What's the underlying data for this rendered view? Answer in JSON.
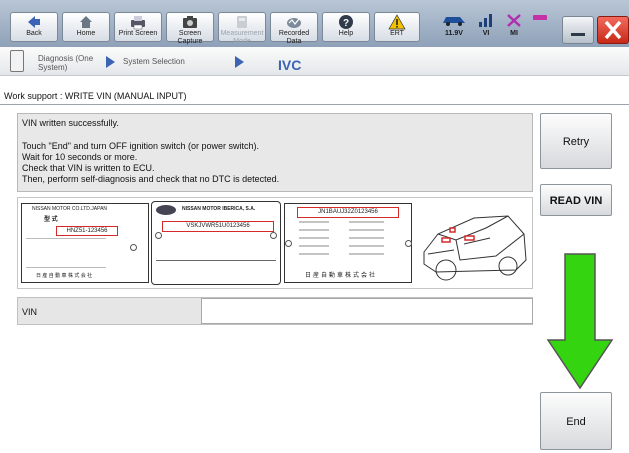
{
  "toolbar": {
    "back": "Back",
    "home": "Home",
    "print_screen": "Print Screen",
    "screen_capture": "Screen Capture",
    "measurement_mode": "Measurement Mode",
    "recorded_data": "Recorded Data",
    "help": "Help",
    "voltage": "11.9V",
    "vi": "VI",
    "mi": "MI"
  },
  "breadcrumb": {
    "diag": "Diagnosis (One System)",
    "system_selection": "System Selection",
    "current": "IVC"
  },
  "work_support_title": "Work support : WRITE VIN (MANUAL INPUT)",
  "message": {
    "line1": "VIN written successfully.",
    "line2": "Touch \"End\" and turn OFF ignition switch (or power switch).",
    "line3": "Wait for 10 seconds or more.",
    "line4": "Check that VIN is written to ECU.",
    "line5": "Then, perform self-diagnosis and check that no DTC is detected."
  },
  "plates": {
    "p1_header": "NISSAN MOTOR CO.LTD.JAPAN",
    "p1_vin": "HNZ51-123456",
    "p1_footer": "日 産 自 動 車 株 式 会 社",
    "p2_header": "NISSAN MOTOR IBERICA, S.A.",
    "p2_vin": "VSKJVWR51U0123456",
    "p3_vin": "JN1BAUJ32Z0123456",
    "p3_footer": "日産自動車株式会社"
  },
  "vin_row": {
    "label": "VIN",
    "value": ""
  },
  "buttons": {
    "retry": "Retry",
    "read_vin": "READ VIN",
    "end": "End"
  },
  "colors": {
    "toolbar_top": "#b9c6d6",
    "accent_blue": "#3a63b5",
    "arrow_green": "#35d411",
    "vin_red": "#d42a2a"
  }
}
